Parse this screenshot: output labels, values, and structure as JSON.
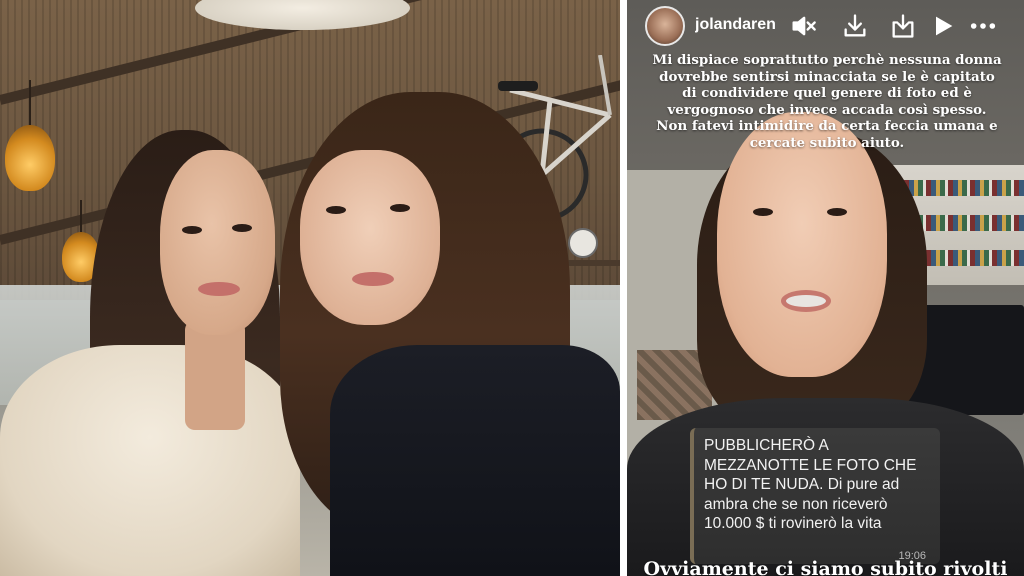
{
  "story": {
    "username": "jolandarenga",
    "caption": "Mi dispiace soprattutto perchè nessuna donna dovrebbe sentirsi minacciata se le è capitato di condividere quel genere di foto ed è vergognoso che invece accada così spesso. Non fatevi intimidire da certa feccia umana e cercate subito aiuto.",
    "message": {
      "line1": "PUBBLICHERÒ A",
      "line2": "MEZZANOTTE LE FOTO CHE",
      "line3": "HO DI TE NUDA. Di pure ad ambra che se non riceverò 10.000 $ ti rovinerò la vita",
      "time": "19:06"
    },
    "footer_text": "Ovviamente ci siamo subito rivolti",
    "controls": [
      "mute-icon",
      "download-icon",
      "save-icon",
      "play-icon",
      "more-icon"
    ]
  },
  "colors": {
    "bubble": "#2e2e2e",
    "text": "#ffffff"
  }
}
